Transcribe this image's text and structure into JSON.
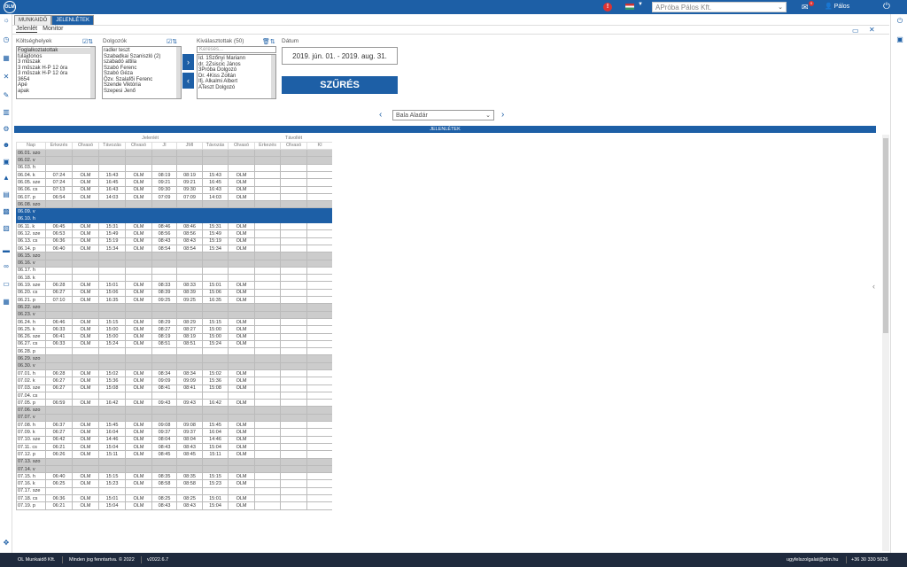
{
  "header": {
    "logo_text": "OLM",
    "alert_badge": "!",
    "company": "APróba Pálos Kft.",
    "mail_badge": "0",
    "user": "Pálos"
  },
  "tabs": [
    "MUNKAIDŐ",
    "JELENLÉTEK"
  ],
  "subtabs": [
    "Jelenlét",
    "Monitor"
  ],
  "filters": {
    "cost_label": "Költséghelyek",
    "cost_items": [
      "Foglalkoztatottak",
      "tulajdonos",
      "3 műszak",
      "3 műszak H-P 12 óra",
      "3 műszak H-P 12 óra",
      "3654",
      "Apé",
      "apak"
    ],
    "workers_label": "Dolgozók",
    "workers_items": [
      "radler teszt",
      "Szabadkai Szaniszló (2)",
      "szabadó attila",
      "Szabó Ferenc",
      "Szabó Géza",
      "Özv. Szalafői Ferenc",
      "Szende Viktória",
      "Szepesi Jenő"
    ],
    "selected_label": "Kiválasztottak (50)",
    "search_placeholder": "Keresés...",
    "selected_items": [
      "Id. 1Szőnyi Mariann",
      "dr. 2Zsiscic János",
      "3Próba Dolgozó",
      "Dr. 4Kiss Zoltán",
      "Ifj. Alkalmi Albert",
      "ATeszt Dolgozó"
    ],
    "date_label": "Dátum",
    "date_value": "2019. jún. 01. - 2019. aug. 31.",
    "filter_button": "SZŰRÉS"
  },
  "person": "Bala Aladár",
  "grid": {
    "title": "JELENLÉTEK",
    "group1": "Jelenlét",
    "group2": "Távollét",
    "columns": [
      "Nap",
      "Érkezés",
      "Olvasó",
      "Távozás",
      "Olvasó",
      "JI",
      "JMI",
      "Távozás",
      "Olvasó",
      "Érkezés",
      "Olvasó",
      "KI"
    ],
    "rows": [
      {
        "d": "06.01. szo",
        "t": "we"
      },
      {
        "d": "06.02. v",
        "t": "we"
      },
      {
        "d": "06.03. h"
      },
      {
        "d": "06.04. k",
        "v": [
          "07:24",
          "OLM",
          "15:43",
          "OLM",
          "08:19",
          "08:19",
          "15:43",
          "OLM"
        ]
      },
      {
        "d": "06.05. sze",
        "v": [
          "07:24",
          "OLM",
          "16:45",
          "OLM",
          "09:21",
          "09:21",
          "16:45",
          "OLM"
        ]
      },
      {
        "d": "06.06. cs",
        "v": [
          "07:13",
          "OLM",
          "16:43",
          "OLM",
          "09:30",
          "09:30",
          "16:43",
          "OLM"
        ]
      },
      {
        "d": "06.07. p",
        "v": [
          "06:54",
          "OLM",
          "14:03",
          "OLM",
          "07:09",
          "07:09",
          "14:03",
          "OLM"
        ]
      },
      {
        "d": "06.08. szo",
        "t": "we"
      },
      {
        "d": "06.09. v",
        "t": "hl"
      },
      {
        "d": "06.10. h",
        "t": "hl"
      },
      {
        "d": "06.11. k",
        "v": [
          "06:45",
          "OLM",
          "15:31",
          "OLM",
          "08:46",
          "08:46",
          "15:31",
          "OLM"
        ]
      },
      {
        "d": "06.12. sze",
        "v": [
          "06:53",
          "OLM",
          "15:49",
          "OLM",
          "08:56",
          "08:56",
          "15:49",
          "OLM"
        ]
      },
      {
        "d": "06.13. cs",
        "v": [
          "06:36",
          "OLM",
          "15:19",
          "OLM",
          "08:43",
          "08:43",
          "15:19",
          "OLM"
        ]
      },
      {
        "d": "06.14. p",
        "v": [
          "06:40",
          "OLM",
          "15:34",
          "OLM",
          "08:54",
          "08:54",
          "15:34",
          "OLM"
        ]
      },
      {
        "d": "06.15. szo",
        "t": "we"
      },
      {
        "d": "06.16. v",
        "t": "we"
      },
      {
        "d": "06.17. h"
      },
      {
        "d": "06.18. k"
      },
      {
        "d": "06.19. sze",
        "v": [
          "06:28",
          "OLM",
          "15:01",
          "OLM",
          "08:33",
          "08:33",
          "15:01",
          "OLM"
        ]
      },
      {
        "d": "06.20. cs",
        "v": [
          "06:27",
          "OLM",
          "15:06",
          "OLM",
          "08:39",
          "08:39",
          "15:06",
          "OLM"
        ]
      },
      {
        "d": "06.21. p",
        "v": [
          "07:10",
          "OLM",
          "16:35",
          "OLM",
          "09:25",
          "09:25",
          "16:35",
          "OLM"
        ]
      },
      {
        "d": "06.22. szo",
        "t": "we"
      },
      {
        "d": "06.23. v",
        "t": "we"
      },
      {
        "d": "06.24. h",
        "v": [
          "06:46",
          "OLM",
          "15:15",
          "OLM",
          "08:29",
          "08:29",
          "15:15",
          "OLM"
        ]
      },
      {
        "d": "06.25. k",
        "v": [
          "06:33",
          "OLM",
          "15:00",
          "OLM",
          "08:27",
          "08:27",
          "15:00",
          "OLM"
        ]
      },
      {
        "d": "06.26. sze",
        "v": [
          "06:41",
          "OLM",
          "15:00",
          "OLM",
          "08:19",
          "08:19",
          "15:00",
          "OLM"
        ]
      },
      {
        "d": "06.27. cs",
        "v": [
          "06:33",
          "OLM",
          "15:24",
          "OLM",
          "08:51",
          "08:51",
          "15:24",
          "OLM"
        ]
      },
      {
        "d": "06.28. p"
      },
      {
        "d": "06.29. szo",
        "t": "we"
      },
      {
        "d": "06.30. v",
        "t": "we"
      },
      {
        "d": "07.01. h",
        "v": [
          "06:28",
          "OLM",
          "15:02",
          "OLM",
          "08:34",
          "08:34",
          "15:02",
          "OLM"
        ]
      },
      {
        "d": "07.02. k",
        "v": [
          "06:27",
          "OLM",
          "15:36",
          "OLM",
          "09:09",
          "09:09",
          "15:36",
          "OLM"
        ]
      },
      {
        "d": "07.03. sze",
        "v": [
          "06:27",
          "OLM",
          "15:08",
          "OLM",
          "08:41",
          "08:41",
          "15:08",
          "OLM"
        ]
      },
      {
        "d": "07.04. cs"
      },
      {
        "d": "07.05. p",
        "v": [
          "06:59",
          "OLM",
          "16:42",
          "OLM",
          "09:43",
          "09:43",
          "16:42",
          "OLM"
        ]
      },
      {
        "d": "07.06. szo",
        "t": "we"
      },
      {
        "d": "07.07. v",
        "t": "we"
      },
      {
        "d": "07.08. h",
        "v": [
          "06:37",
          "OLM",
          "15:45",
          "OLM",
          "09:08",
          "09:08",
          "15:45",
          "OLM"
        ]
      },
      {
        "d": "07.09. k",
        "v": [
          "06:27",
          "OLM",
          "16:04",
          "OLM",
          "09:37",
          "09:37",
          "16:04",
          "OLM"
        ]
      },
      {
        "d": "07.10. sze",
        "v": [
          "06:42",
          "OLM",
          "14:46",
          "OLM",
          "08:04",
          "08:04",
          "14:46",
          "OLM"
        ]
      },
      {
        "d": "07.11. cs",
        "v": [
          "06:21",
          "OLM",
          "15:04",
          "OLM",
          "08:43",
          "08:43",
          "15:04",
          "OLM"
        ]
      },
      {
        "d": "07.12. p",
        "v": [
          "06:26",
          "OLM",
          "15:11",
          "OLM",
          "08:45",
          "08:45",
          "15:11",
          "OLM"
        ]
      },
      {
        "d": "07.13. szo",
        "t": "we"
      },
      {
        "d": "07.14. v",
        "t": "we"
      },
      {
        "d": "07.15. h",
        "v": [
          "06:40",
          "OLM",
          "15:15",
          "OLM",
          "08:35",
          "08:35",
          "15:15",
          "OLM"
        ]
      },
      {
        "d": "07.16. k",
        "v": [
          "06:25",
          "OLM",
          "15:23",
          "OLM",
          "08:58",
          "08:58",
          "15:23",
          "OLM"
        ]
      },
      {
        "d": "07.17. sze"
      },
      {
        "d": "07.18. cs",
        "v": [
          "06:36",
          "OLM",
          "15:01",
          "OLM",
          "08:25",
          "08:25",
          "15:01",
          "OLM"
        ]
      },
      {
        "d": "07.19. p",
        "v": [
          "06:21",
          "OLM",
          "15:04",
          "OLM",
          "08:43",
          "08:43",
          "15:04",
          "OLM"
        ]
      }
    ]
  },
  "footer": {
    "company": "OL Munkaidő Kft.",
    "rights": "Minden jog fenntartva. © 2022",
    "version": "v2022.6.7",
    "email": "ugyfelszolgalat@olm.hu",
    "phone": "+36 30 330 5626"
  }
}
